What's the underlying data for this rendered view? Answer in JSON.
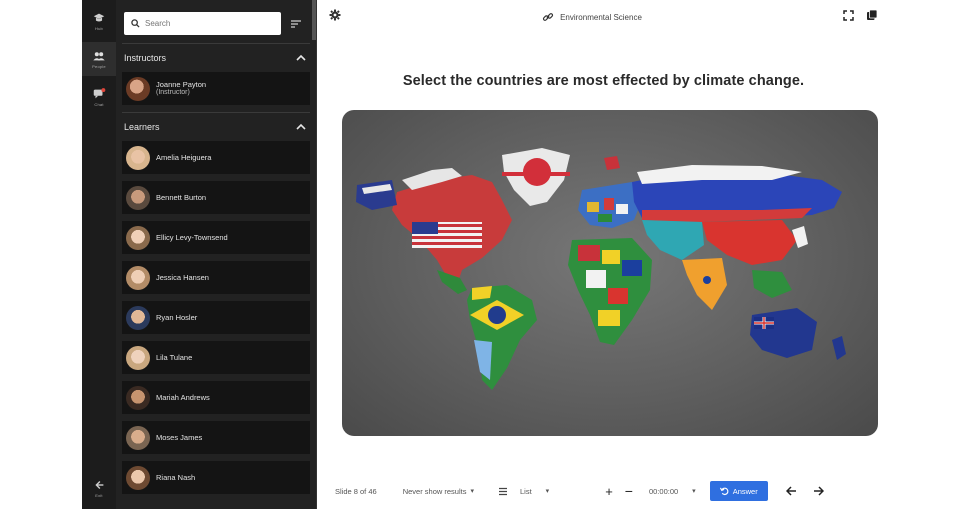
{
  "rail": {
    "items": [
      {
        "label": "Hub",
        "icon": "hat-icon"
      },
      {
        "label": "People",
        "icon": "people-icon"
      },
      {
        "label": "Chat",
        "icon": "chat-icon"
      }
    ],
    "bottom_label": "Exit"
  },
  "people_panel": {
    "search_placeholder": "Search",
    "instructors_heading": "Instructors",
    "instructors": [
      {
        "name": "Joanne Payton",
        "role": "(Instructor)"
      }
    ],
    "learners_heading": "Learners",
    "learners": [
      {
        "name": "Amelia Heiguera"
      },
      {
        "name": "Bennett Burton"
      },
      {
        "name": "Ellicy Levy-Townsend"
      },
      {
        "name": "Jessica Hansen"
      },
      {
        "name": "Ryan Hosler"
      },
      {
        "name": "Lila Tulane"
      },
      {
        "name": "Mariah Andrews"
      },
      {
        "name": "Moses James"
      },
      {
        "name": "Riana Nash"
      }
    ]
  },
  "main": {
    "session_title": "Environmental Science",
    "question": "Select the countries are most effected by climate change.",
    "bottombar": {
      "slide_counter": "Slide 8 of 46",
      "results_select": "Never show results",
      "view_select": "List",
      "timer": "00:00:00",
      "answer_button": "Answer"
    }
  },
  "colors": {
    "rail_bg": "#1c1c1c",
    "panel_bg": "#222222",
    "accent": "#2f6fe0"
  }
}
